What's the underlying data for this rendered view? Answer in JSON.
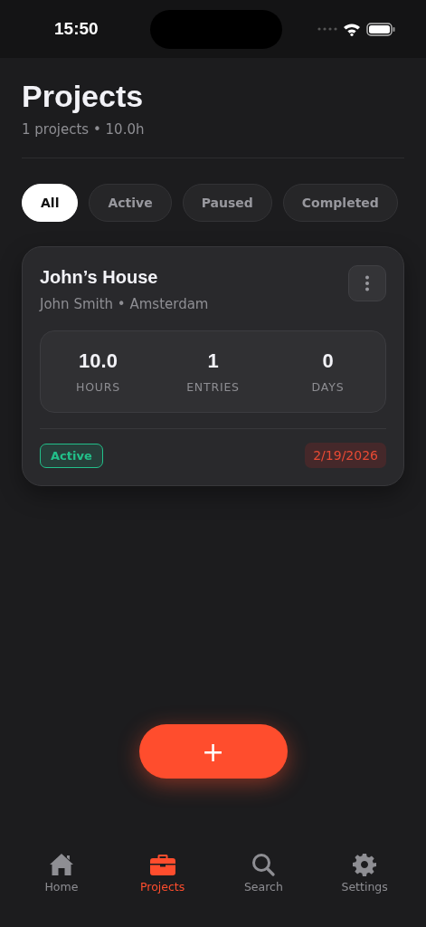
{
  "status_bar": {
    "time": "15:50"
  },
  "header": {
    "title": "Projects",
    "summary": "1 projects • 10.0h"
  },
  "filters": [
    {
      "label": "All",
      "selected": true
    },
    {
      "label": "Active",
      "selected": false
    },
    {
      "label": "Paused",
      "selected": false
    },
    {
      "label": "Completed",
      "selected": false
    }
  ],
  "projects": [
    {
      "name": "John’s House",
      "client": "John Smith • Amsterdam",
      "stats": [
        {
          "value": "10.0",
          "label": "HOURS"
        },
        {
          "value": "1",
          "label": "ENTRIES"
        },
        {
          "value": "0",
          "label": "DAYS"
        }
      ],
      "status": {
        "label": "Active",
        "kind": "active"
      },
      "date": "2/19/2026"
    }
  ],
  "fab": {
    "label": "+"
  },
  "tab_bar": [
    {
      "label": "Home",
      "kind": "home",
      "selected": false
    },
    {
      "label": "Projects",
      "kind": "projects",
      "selected": true
    },
    {
      "label": "Search",
      "kind": "search",
      "selected": false
    },
    {
      "label": "Settings",
      "kind": "settings",
      "selected": false
    }
  ]
}
